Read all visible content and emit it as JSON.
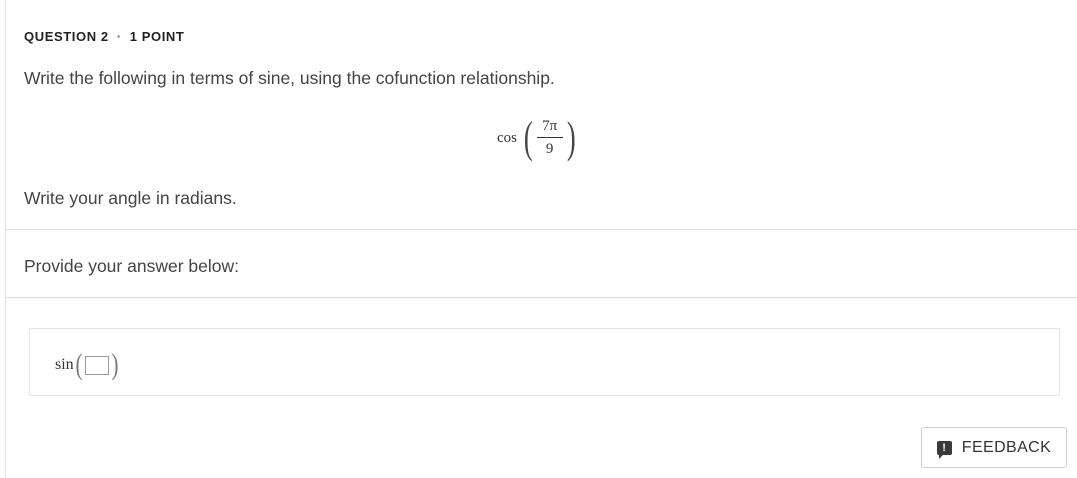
{
  "question": {
    "label": "QUESTION 2",
    "separator": "·",
    "points": "1 POINT",
    "prompt": "Write the following in terms of sine, using the cofunction relationship.",
    "expression": {
      "function": "cos",
      "numerator": "7π",
      "denominator": "9"
    },
    "instruction": "Write your angle in radians."
  },
  "answer": {
    "label": "Provide your answer below:",
    "function": "sin",
    "value": ""
  },
  "feedback": {
    "label": "FEEDBACK",
    "icon": "feedback-exclamation-icon",
    "icon_glyph": "!"
  }
}
